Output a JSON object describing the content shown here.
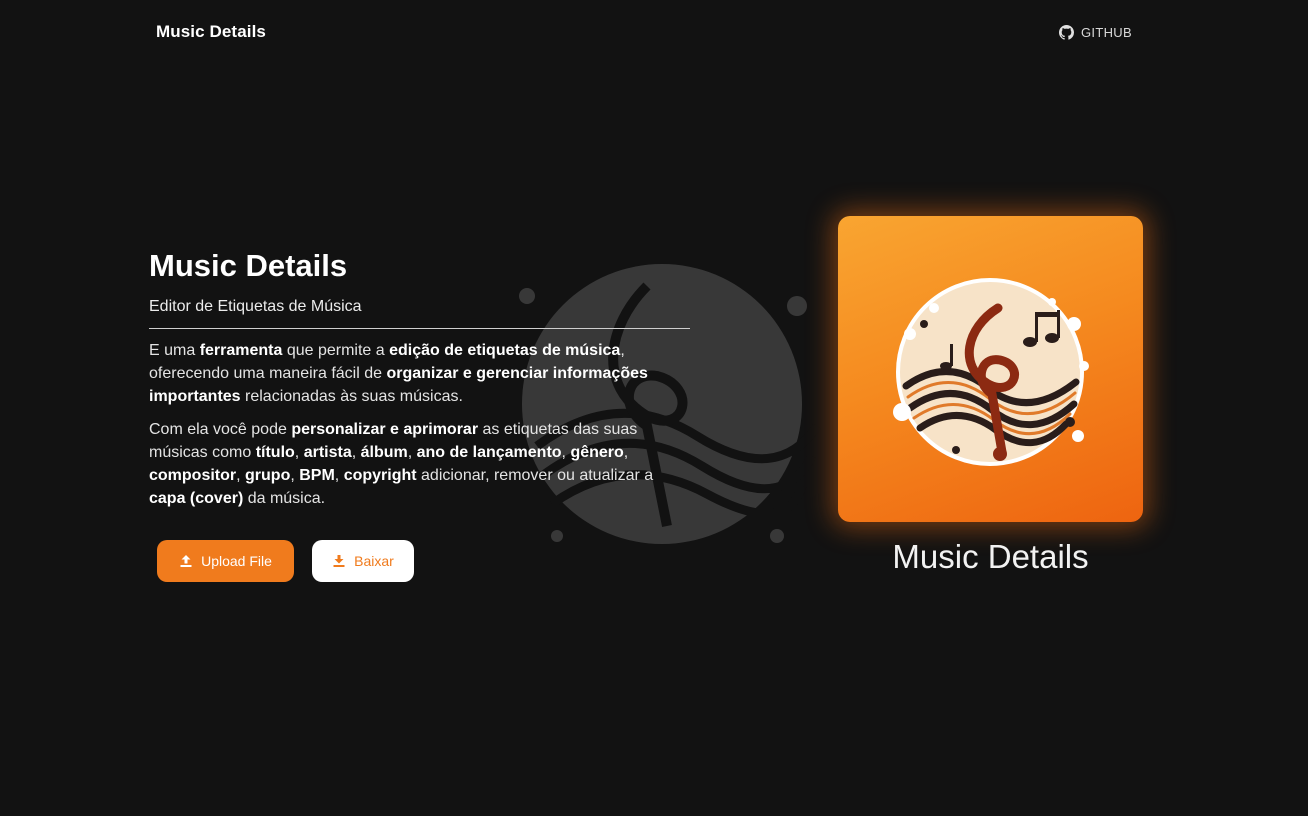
{
  "navbar": {
    "brand": "Music Details",
    "github_label": "GITHUB",
    "github_icon": "github-icon"
  },
  "hero": {
    "title": "Music Details",
    "subtitle": "Editor de Etiquetas de Música",
    "p1": {
      "t1": "E uma ",
      "b1": "ferramenta",
      "t2": " que permite a ",
      "b2": "edição de etiquetas de música",
      "t3": ", oferecendo uma maneira fácil de ",
      "b3": "organizar e gerenciar informações importantes",
      "t4": " relacionadas às suas músicas."
    },
    "p2": {
      "t1": "Com ela você pode ",
      "b1": "personalizar e aprimorar",
      "t2": " as etiquetas das suas músicas como ",
      "b2": "título",
      "t3": ", ",
      "b3": "artista",
      "t4": ", ",
      "b4": "álbum",
      "t5": ", ",
      "b5": "ano de lançamento",
      "t6": ", ",
      "b6": "gênero",
      "t7": ", ",
      "b7": "compositor",
      "t8": ", ",
      "b8": "grupo",
      "t9": ", ",
      "b9": "BPM",
      "t10": ", ",
      "b10": "copyright",
      "t11": " adicionar, remover ou atualizar a ",
      "b11": "capa (cover)",
      "t12": " da música."
    }
  },
  "actions": {
    "upload_label": "Upload File",
    "upload_icon": "upload-icon",
    "download_label": "Baixar",
    "download_icon": "download-icon"
  },
  "cover": {
    "caption": "Music Details",
    "art_icon": "treble-clef-icon"
  },
  "colors": {
    "accent": "#f07b1d",
    "background": "#121212",
    "text": "#ffffff"
  }
}
